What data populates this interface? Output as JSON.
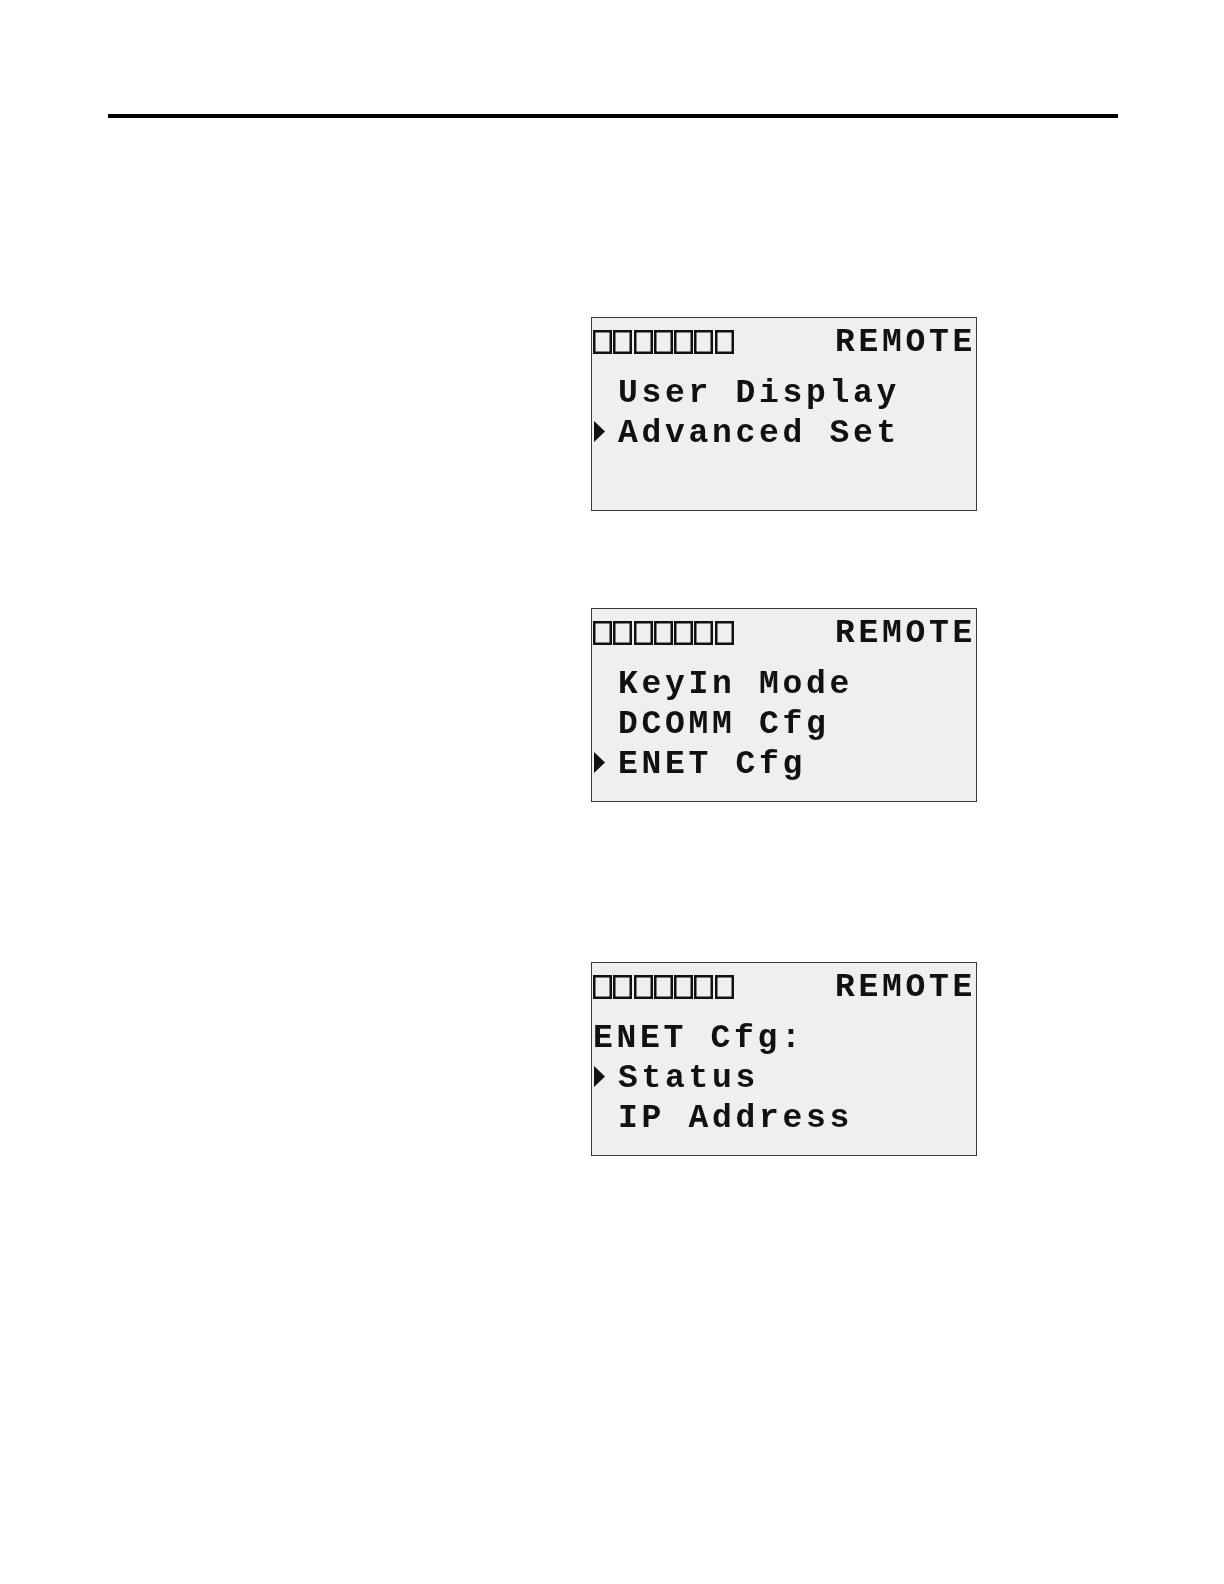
{
  "screens": [
    {
      "mode": "REMOTE",
      "items": [
        {
          "label": "User Display",
          "selected": false
        },
        {
          "label": "Advanced Set",
          "selected": true
        }
      ]
    },
    {
      "mode": "REMOTE",
      "items": [
        {
          "label": "KeyIn Mode",
          "selected": false
        },
        {
          "label": "DCOMM Cfg",
          "selected": false
        },
        {
          "label": "ENET Cfg",
          "selected": true
        }
      ]
    },
    {
      "mode": "REMOTE",
      "title": "ENET Cfg:",
      "items": [
        {
          "label": "Status",
          "selected": true
        },
        {
          "label": "IP Address",
          "selected": false
        }
      ]
    }
  ]
}
